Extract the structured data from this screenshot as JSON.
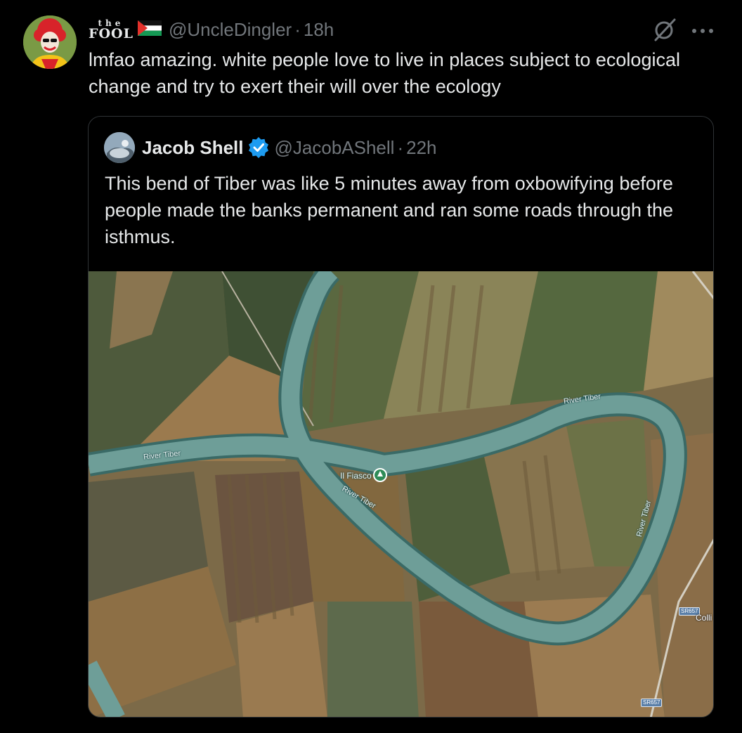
{
  "tweet": {
    "display_name_small": "the",
    "display_name_big": "FOOL",
    "handle": "@UncleDingler",
    "separator": "·",
    "time": "18h",
    "text": "lmfao amazing. white people love to live in places subject to ecological change and try to exert their will over the ecology",
    "icons": [
      "grok-icon",
      "more-icon",
      "palestine-flag-icon"
    ]
  },
  "quote": {
    "name": "Jacob Shell",
    "handle": "@JacobAShell",
    "separator": "·",
    "time": "22h",
    "text": "This bend of Tiber was like 5 minutes away from oxbowifying before people made the banks permanent and ran some roads through the isthmus.",
    "verified_color": "#1d9bf0"
  },
  "map": {
    "river_label_right": "River Tiber",
    "river_label_left": "River Tiber",
    "river_label_middle": "River Tiber",
    "river_label_vertical": "River Tiber",
    "poi_name": "Il Fiasco",
    "road_badge_1": "SR657",
    "road_badge_2": "SR657",
    "place_name": "Colli"
  }
}
